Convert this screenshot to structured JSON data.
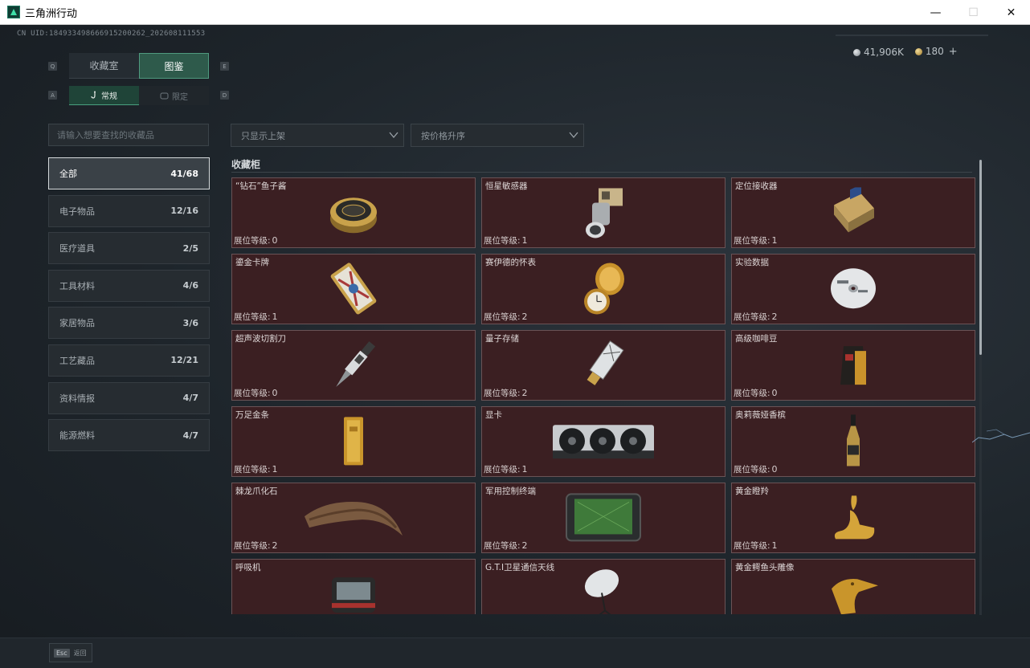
{
  "window": {
    "title": "三角洲行动",
    "minimize": "—",
    "maximize": "☐",
    "close": "✕"
  },
  "header": {
    "uid": "CN UID:184933498666915200262_202608111553",
    "currency_silver": "41,906K",
    "currency_gold": "180",
    "add": "+"
  },
  "keys": {
    "q": "Q",
    "e": "E",
    "a": "A",
    "d": "D"
  },
  "tabs": [
    {
      "label": "收藏室",
      "active": false
    },
    {
      "label": "图鉴",
      "active": true
    }
  ],
  "subtabs": [
    {
      "label": "常规",
      "active": true
    },
    {
      "label": "限定",
      "active": false
    }
  ],
  "search": {
    "placeholder": "请输入想要查找的收藏品"
  },
  "filters": {
    "shelf_filter": "只显示上架",
    "sort": "按价格升序"
  },
  "categories": [
    {
      "label": "全部",
      "count": "41/68",
      "active": true
    },
    {
      "label": "电子物品",
      "count": "12/16"
    },
    {
      "label": "医疗道具",
      "count": "2/5"
    },
    {
      "label": "工具材料",
      "count": "4/6"
    },
    {
      "label": "家居物品",
      "count": "3/6"
    },
    {
      "label": "工艺藏品",
      "count": "12/21"
    },
    {
      "label": "资料情报",
      "count": "4/7"
    },
    {
      "label": "能源燃料",
      "count": "4/7"
    }
  ],
  "section_title": "收藏柜",
  "level_label": "展位等级:",
  "items": [
    {
      "name": "“钻石”鱼子酱",
      "level": "0",
      "icon": "caviar-tin"
    },
    {
      "name": "恒星敏感器",
      "level": "1",
      "icon": "star-sensor"
    },
    {
      "name": "定位接收器",
      "level": "1",
      "icon": "gps-receiver"
    },
    {
      "name": "鎏金卡牌",
      "level": "1",
      "icon": "gilded-card"
    },
    {
      "name": "赛伊德的怀表",
      "level": "2",
      "icon": "pocket-watch"
    },
    {
      "name": "实验数据",
      "level": "2",
      "icon": "data-disc"
    },
    {
      "name": "超声波切割刀",
      "level": "0",
      "icon": "ultrasonic-cutter"
    },
    {
      "name": "量子存储",
      "level": "2",
      "icon": "quantum-storage"
    },
    {
      "name": "高级咖啡豆",
      "level": "0",
      "icon": "coffee-bag"
    },
    {
      "name": "万足金条",
      "level": "1",
      "icon": "gold-bar"
    },
    {
      "name": "显卡",
      "level": "1",
      "icon": "graphics-card"
    },
    {
      "name": "奥莉薇娅香槟",
      "level": "0",
      "icon": "champagne"
    },
    {
      "name": "棘龙爪化石",
      "level": "2",
      "icon": "claw-fossil"
    },
    {
      "name": "军用控制终端",
      "level": "2",
      "icon": "control-terminal"
    },
    {
      "name": "黄金瞪羚",
      "level": "1",
      "icon": "gold-gazelle"
    },
    {
      "name": "呼吸机",
      "level": "",
      "icon": "respirator"
    },
    {
      "name": "G.T.I卫星通信天线",
      "level": "",
      "icon": "satellite-antenna"
    },
    {
      "name": "黄金鳄鱼头雕像",
      "level": "",
      "icon": "gold-crocodile"
    }
  ],
  "footer": {
    "esc_key": "Esc",
    "esc_label": "返回"
  }
}
